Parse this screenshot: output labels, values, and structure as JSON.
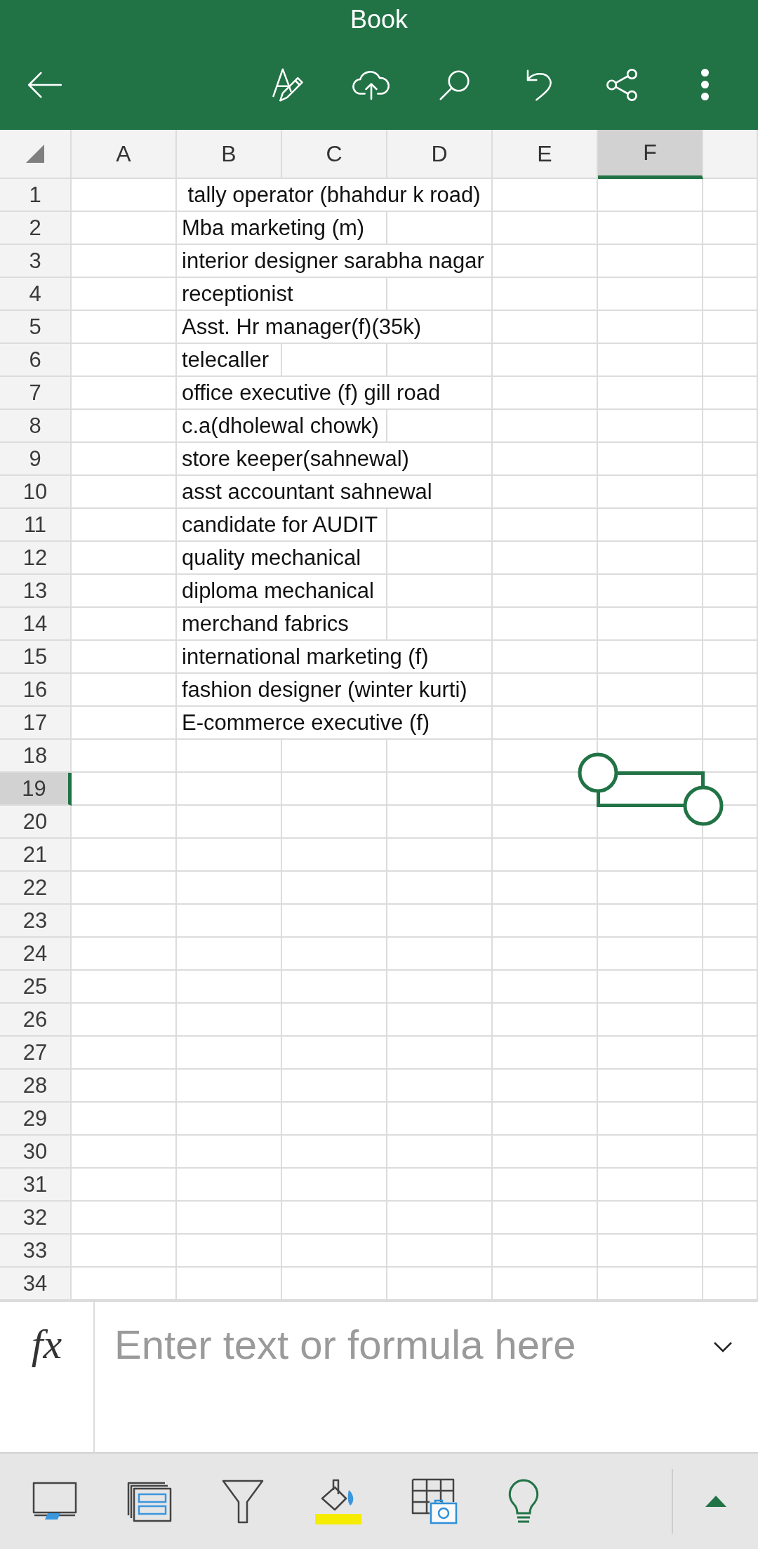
{
  "title_bar": {
    "title": "Book"
  },
  "sheet": {
    "columns": [
      {
        "label": "A",
        "selected": false
      },
      {
        "label": "B",
        "selected": false
      },
      {
        "label": "C",
        "selected": false
      },
      {
        "label": "D",
        "selected": false
      },
      {
        "label": "E",
        "selected": false
      },
      {
        "label": "F",
        "selected": true
      }
    ],
    "rows": [
      {
        "number": "1",
        "selected": false,
        "column_b": " tally operator (bhahdur k road)"
      },
      {
        "number": "2",
        "selected": false,
        "column_b": "Mba marketing (m)"
      },
      {
        "number": "3",
        "selected": false,
        "column_b": "interior designer sarabha nagar"
      },
      {
        "number": "4",
        "selected": false,
        "column_b": "receptionist"
      },
      {
        "number": "5",
        "selected": false,
        "column_b": "Asst. Hr manager(f)(35k)"
      },
      {
        "number": "6",
        "selected": false,
        "column_b": "telecaller"
      },
      {
        "number": "7",
        "selected": false,
        "column_b": "office executive (f) gill road"
      },
      {
        "number": "8",
        "selected": false,
        "column_b": "c.a(dholewal chowk)"
      },
      {
        "number": "9",
        "selected": false,
        "column_b": "store keeper(sahnewal)"
      },
      {
        "number": "10",
        "selected": false,
        "column_b": "asst accountant sahnewal"
      },
      {
        "number": "11",
        "selected": false,
        "column_b": "candidate for AUDIT"
      },
      {
        "number": "12",
        "selected": false,
        "column_b": "quality mechanical"
      },
      {
        "number": "13",
        "selected": false,
        "column_b": "diploma mechanical"
      },
      {
        "number": "14",
        "selected": false,
        "column_b": "merchand fabrics"
      },
      {
        "number": "15",
        "selected": false,
        "column_b": "international marketing (f)"
      },
      {
        "number": "16",
        "selected": false,
        "column_b": "fashion designer (winter kurti)"
      },
      {
        "number": "17",
        "selected": false,
        "column_b": "E-commerce executive (f)"
      },
      {
        "number": "18",
        "selected": false
      },
      {
        "number": "19",
        "selected": true
      },
      {
        "number": "20",
        "selected": false
      },
      {
        "number": "21",
        "selected": false
      },
      {
        "number": "22",
        "selected": false
      },
      {
        "number": "23",
        "selected": false
      },
      {
        "number": "24",
        "selected": false
      },
      {
        "number": "25",
        "selected": false
      },
      {
        "number": "26",
        "selected": false
      },
      {
        "number": "27",
        "selected": false
      },
      {
        "number": "28",
        "selected": false
      },
      {
        "number": "29",
        "selected": false
      },
      {
        "number": "30",
        "selected": false
      },
      {
        "number": "31",
        "selected": false
      },
      {
        "number": "32",
        "selected": false
      },
      {
        "number": "33",
        "selected": false
      },
      {
        "number": "34",
        "selected": false
      }
    ]
  },
  "formula_bar": {
    "label": "fx",
    "placeholder": "Enter text or formula here"
  }
}
